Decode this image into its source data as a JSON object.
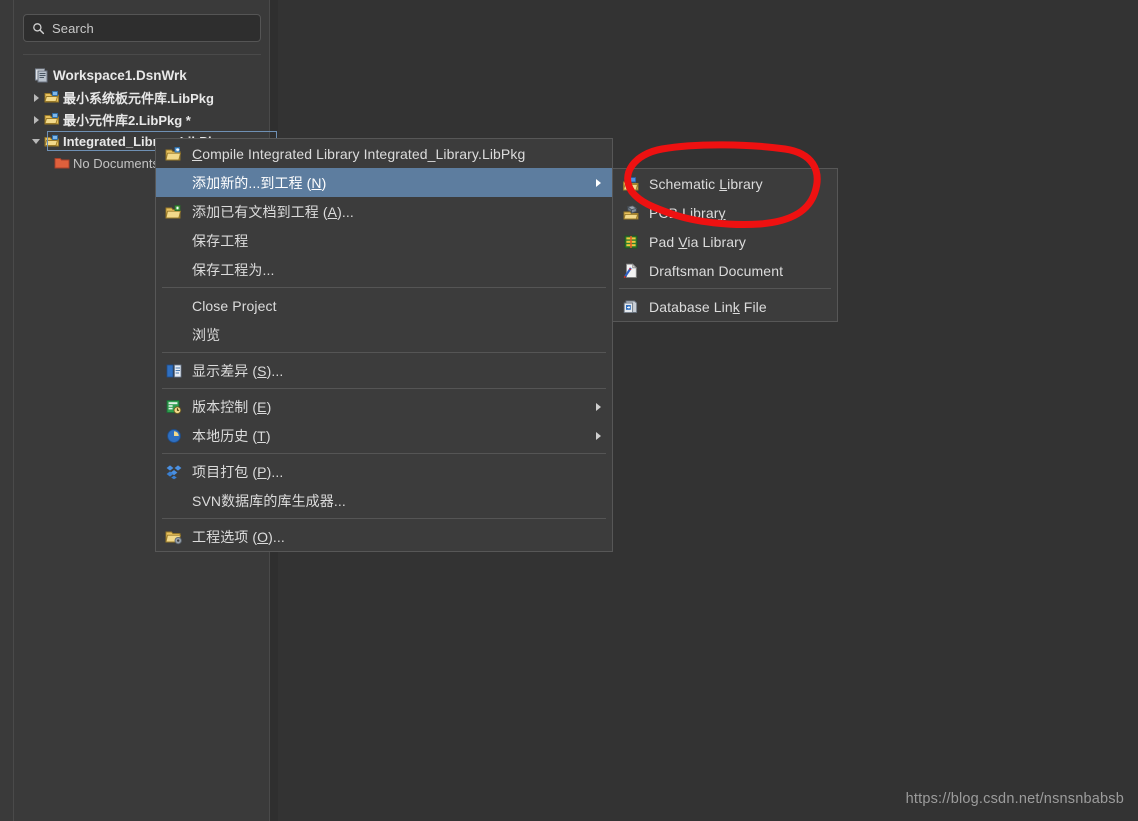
{
  "colors": {
    "app_background": "#333333",
    "panel_background": "#3a3a3a",
    "menu_background": "#3c3c3c",
    "menu_highlight": "#5d7d9f",
    "annotation_red": "#ee1111",
    "text_primary": "#dcdcdc",
    "watermark": "#9c9c9c"
  },
  "panel": {
    "search": {
      "icon": "search-icon",
      "placeholder": "Search",
      "value": ""
    },
    "tree": [
      {
        "label": "Workspace1.DsnWrk",
        "icon": "workspace-icon",
        "level": 0,
        "twisty": "none",
        "bold": true,
        "selected": false
      },
      {
        "label": "最小系统板元件库.LibPkg",
        "icon": "libpkg-icon",
        "level": 1,
        "twisty": "collapsed",
        "bold": true,
        "selected": false
      },
      {
        "label": "最小元件库2.LibPkg *",
        "icon": "libpkg-icon",
        "level": 1,
        "twisty": "collapsed",
        "bold": true,
        "selected": false
      },
      {
        "label": "Integrated_Library.LibPkg",
        "icon": "libpkg-icon",
        "level": 1,
        "twisty": "expanded",
        "bold": true,
        "selected": true
      },
      {
        "label": "No Documents Added",
        "icon": "folder-icon",
        "level": 2,
        "twisty": "none",
        "bold": false,
        "selected": false
      }
    ]
  },
  "context_menu": {
    "items": [
      {
        "id": "compile-integrated-library",
        "label": "Compile Integrated Library Integrated_Library.LibPkg",
        "accel": "C",
        "icon": "compile-folder-icon",
        "highlighted": false,
        "submenu": false,
        "separator_after": false
      },
      {
        "id": "add-new-to-project",
        "label": "添加新的...到工程 (N)",
        "accel": "N",
        "icon": "none",
        "highlighted": true,
        "submenu": true,
        "separator_after": false
      },
      {
        "id": "add-existing-to-project",
        "label": "添加已有文档到工程 (A)...",
        "accel": "A",
        "icon": "add-folder-icon",
        "highlighted": false,
        "submenu": false,
        "separator_after": false
      },
      {
        "id": "save-project",
        "label": "保存工程",
        "accel": "",
        "icon": "none",
        "highlighted": false,
        "submenu": false,
        "separator_after": false
      },
      {
        "id": "save-project-as",
        "label": "保存工程为...",
        "accel": "",
        "icon": "none",
        "highlighted": false,
        "submenu": false,
        "separator_after": true
      },
      {
        "id": "close-project",
        "label": "Close Project",
        "accel": "",
        "icon": "none",
        "highlighted": false,
        "submenu": false,
        "separator_after": false
      },
      {
        "id": "browse",
        "label": "浏览",
        "accel": "",
        "icon": "none",
        "highlighted": false,
        "submenu": false,
        "separator_after": true
      },
      {
        "id": "show-differences",
        "label": "显示差异 (S)...",
        "accel": "S",
        "icon": "diff-icon",
        "highlighted": false,
        "submenu": false,
        "separator_after": true
      },
      {
        "id": "version-control",
        "label": "版本控制 (E)",
        "accel": "E",
        "icon": "version-control-icon",
        "highlighted": false,
        "submenu": true,
        "separator_after": false
      },
      {
        "id": "local-history",
        "label": "本地历史 (T)",
        "accel": "T",
        "icon": "clock-icon",
        "highlighted": false,
        "submenu": true,
        "separator_after": true
      },
      {
        "id": "project-packager",
        "label": "项目打包 (P)...",
        "accel": "P",
        "icon": "package-icon",
        "highlighted": false,
        "submenu": false,
        "separator_after": false
      },
      {
        "id": "svn-library-generator",
        "label": "SVN数据库的库生成器...",
        "accel": "",
        "icon": "none",
        "highlighted": false,
        "submenu": false,
        "separator_after": true
      },
      {
        "id": "project-options",
        "label": "工程选项 (O)...",
        "accel": "O",
        "icon": "project-options-icon",
        "highlighted": false,
        "submenu": false,
        "separator_after": false
      }
    ]
  },
  "submenu": {
    "items": [
      {
        "id": "schematic-library",
        "label": "Schematic Library",
        "accel": "L",
        "icon": "schematic-library-icon",
        "separator_after": false
      },
      {
        "id": "pcb-library",
        "label": "PCB Library",
        "accel": "y",
        "icon": "pcb-library-icon",
        "separator_after": false
      },
      {
        "id": "pad-via-library",
        "label": "Pad Via Library",
        "accel": "V",
        "icon": "pad-via-library-icon",
        "separator_after": false
      },
      {
        "id": "draftsman-document",
        "label": "Draftsman Document",
        "accel": "",
        "icon": "draftsman-icon",
        "separator_after": true
      },
      {
        "id": "database-link-file",
        "label": "Database Link File",
        "accel": "k",
        "icon": "database-link-icon",
        "separator_after": false
      }
    ]
  },
  "annotation": {
    "shape": "hand-drawn-red-ellipse",
    "target": "Schematic Library / PCB Library"
  },
  "watermark": {
    "text": "https://blog.csdn.net/nsnsnbabsb"
  }
}
